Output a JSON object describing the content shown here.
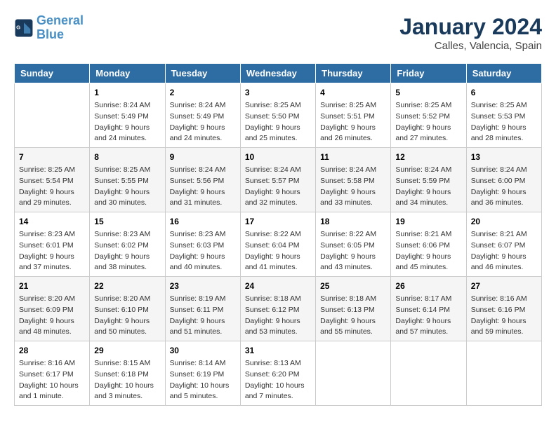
{
  "header": {
    "logo_line1": "General",
    "logo_line2": "Blue",
    "month_title": "January 2024",
    "location": "Calles, Valencia, Spain"
  },
  "days_of_week": [
    "Sunday",
    "Monday",
    "Tuesday",
    "Wednesday",
    "Thursday",
    "Friday",
    "Saturday"
  ],
  "weeks": [
    [
      {
        "day": "",
        "info": ""
      },
      {
        "day": "1",
        "info": "Sunrise: 8:24 AM\nSunset: 5:49 PM\nDaylight: 9 hours and 24 minutes."
      },
      {
        "day": "2",
        "info": "Sunrise: 8:24 AM\nSunset: 5:49 PM\nDaylight: 9 hours and 24 minutes."
      },
      {
        "day": "3",
        "info": "Sunrise: 8:25 AM\nSunset: 5:50 PM\nDaylight: 9 hours and 25 minutes."
      },
      {
        "day": "4",
        "info": "Sunrise: 8:25 AM\nSunset: 5:51 PM\nDaylight: 9 hours and 26 minutes."
      },
      {
        "day": "5",
        "info": "Sunrise: 8:25 AM\nSunset: 5:52 PM\nDaylight: 9 hours and 27 minutes."
      },
      {
        "day": "6",
        "info": "Sunrise: 8:25 AM\nSunset: 5:53 PM\nDaylight: 9 hours and 28 minutes."
      }
    ],
    [
      {
        "day": "7",
        "info": "Sunrise: 8:25 AM\nSunset: 5:54 PM\nDaylight: 9 hours and 29 minutes."
      },
      {
        "day": "8",
        "info": "Sunrise: 8:25 AM\nSunset: 5:55 PM\nDaylight: 9 hours and 30 minutes."
      },
      {
        "day": "9",
        "info": "Sunrise: 8:24 AM\nSunset: 5:56 PM\nDaylight: 9 hours and 31 minutes."
      },
      {
        "day": "10",
        "info": "Sunrise: 8:24 AM\nSunset: 5:57 PM\nDaylight: 9 hours and 32 minutes."
      },
      {
        "day": "11",
        "info": "Sunrise: 8:24 AM\nSunset: 5:58 PM\nDaylight: 9 hours and 33 minutes."
      },
      {
        "day": "12",
        "info": "Sunrise: 8:24 AM\nSunset: 5:59 PM\nDaylight: 9 hours and 34 minutes."
      },
      {
        "day": "13",
        "info": "Sunrise: 8:24 AM\nSunset: 6:00 PM\nDaylight: 9 hours and 36 minutes."
      }
    ],
    [
      {
        "day": "14",
        "info": "Sunrise: 8:23 AM\nSunset: 6:01 PM\nDaylight: 9 hours and 37 minutes."
      },
      {
        "day": "15",
        "info": "Sunrise: 8:23 AM\nSunset: 6:02 PM\nDaylight: 9 hours and 38 minutes."
      },
      {
        "day": "16",
        "info": "Sunrise: 8:23 AM\nSunset: 6:03 PM\nDaylight: 9 hours and 40 minutes."
      },
      {
        "day": "17",
        "info": "Sunrise: 8:22 AM\nSunset: 6:04 PM\nDaylight: 9 hours and 41 minutes."
      },
      {
        "day": "18",
        "info": "Sunrise: 8:22 AM\nSunset: 6:05 PM\nDaylight: 9 hours and 43 minutes."
      },
      {
        "day": "19",
        "info": "Sunrise: 8:21 AM\nSunset: 6:06 PM\nDaylight: 9 hours and 45 minutes."
      },
      {
        "day": "20",
        "info": "Sunrise: 8:21 AM\nSunset: 6:07 PM\nDaylight: 9 hours and 46 minutes."
      }
    ],
    [
      {
        "day": "21",
        "info": "Sunrise: 8:20 AM\nSunset: 6:09 PM\nDaylight: 9 hours and 48 minutes."
      },
      {
        "day": "22",
        "info": "Sunrise: 8:20 AM\nSunset: 6:10 PM\nDaylight: 9 hours and 50 minutes."
      },
      {
        "day": "23",
        "info": "Sunrise: 8:19 AM\nSunset: 6:11 PM\nDaylight: 9 hours and 51 minutes."
      },
      {
        "day": "24",
        "info": "Sunrise: 8:18 AM\nSunset: 6:12 PM\nDaylight: 9 hours and 53 minutes."
      },
      {
        "day": "25",
        "info": "Sunrise: 8:18 AM\nSunset: 6:13 PM\nDaylight: 9 hours and 55 minutes."
      },
      {
        "day": "26",
        "info": "Sunrise: 8:17 AM\nSunset: 6:14 PM\nDaylight: 9 hours and 57 minutes."
      },
      {
        "day": "27",
        "info": "Sunrise: 8:16 AM\nSunset: 6:16 PM\nDaylight: 9 hours and 59 minutes."
      }
    ],
    [
      {
        "day": "28",
        "info": "Sunrise: 8:16 AM\nSunset: 6:17 PM\nDaylight: 10 hours and 1 minute."
      },
      {
        "day": "29",
        "info": "Sunrise: 8:15 AM\nSunset: 6:18 PM\nDaylight: 10 hours and 3 minutes."
      },
      {
        "day": "30",
        "info": "Sunrise: 8:14 AM\nSunset: 6:19 PM\nDaylight: 10 hours and 5 minutes."
      },
      {
        "day": "31",
        "info": "Sunrise: 8:13 AM\nSunset: 6:20 PM\nDaylight: 10 hours and 7 minutes."
      },
      {
        "day": "",
        "info": ""
      },
      {
        "day": "",
        "info": ""
      },
      {
        "day": "",
        "info": ""
      }
    ]
  ]
}
